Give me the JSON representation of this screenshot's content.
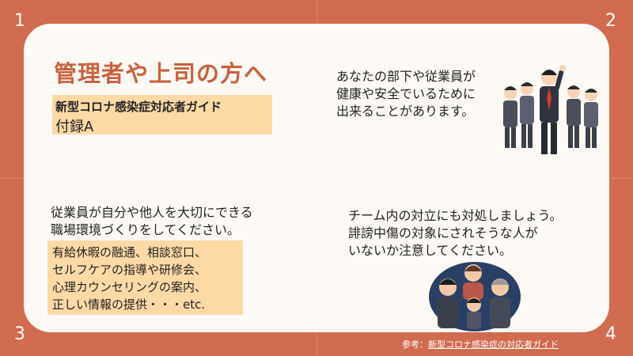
{
  "corners": [
    "1",
    "2",
    "3",
    "4"
  ],
  "title": "管理者や上司の方へ",
  "tag": {
    "line1": "新型コロナ感染症対応者ガイド",
    "line2": "付録A"
  },
  "top_right_text": [
    "あなたの部下や従業員が",
    "健康や安全でいるために",
    "出来ることがあります。"
  ],
  "mid_left_text": [
    "従業員が自分や他人を大切にできる",
    "職場環境づくりをしてください。"
  ],
  "list_items": [
    "有給休暇の融通、相談窓口、",
    "セルフケアの指導や研修会、",
    "心理カウンセリングの案内、",
    "正しい情報の提供・・・etc."
  ],
  "mid_right_text": [
    "チーム内の対立にも対処しましょう。",
    "誹謗中傷の対象にされそうな人が",
    "いないか注意してください。"
  ],
  "reference": {
    "prefix": "参考：",
    "link": "新型コロナ感染症の対応者ガイド"
  },
  "illustrations": {
    "top": "cheering-team-illustration",
    "bottom": "bullying-group-illustration"
  },
  "colors": {
    "frame": "#d16b4f",
    "panel": "#fdfaf6",
    "title": "#c9623f",
    "highlight": "#fdd9a6"
  }
}
